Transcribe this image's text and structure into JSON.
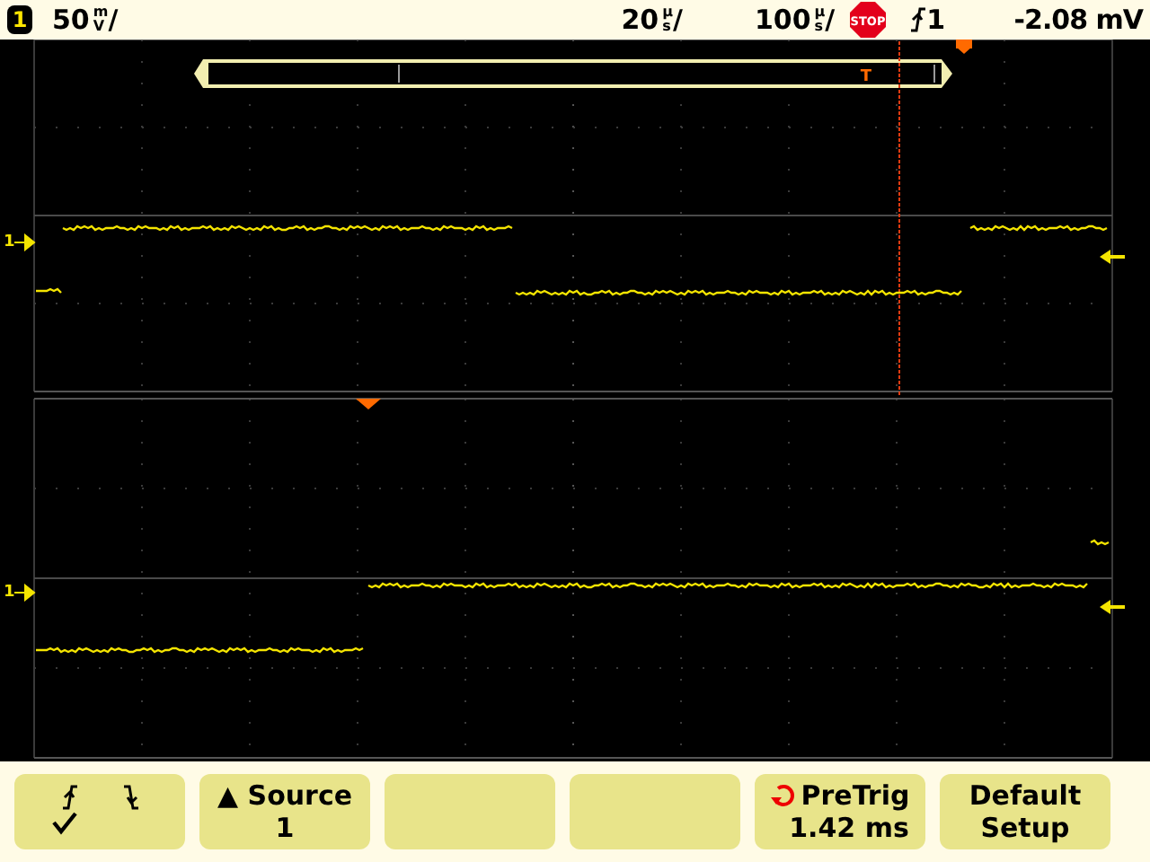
{
  "status_bar": {
    "channel": "1",
    "scale": {
      "value": "50",
      "unit_top": "m",
      "unit_bottom": "V",
      "slash": "/"
    },
    "delay": {
      "value": "20",
      "unit_top": "µ",
      "unit_bottom": "s",
      "slash": "/"
    },
    "timebase": {
      "value": "100",
      "unit_top": "µ",
      "unit_bottom": "s",
      "slash": "/"
    },
    "run_state": "STOP",
    "trigger_source": "1",
    "trigger_level": "-2.08 mV"
  },
  "display": {
    "zoom_marker": "T",
    "ground_markers": [
      {
        "label": "1"
      },
      {
        "label": "1"
      }
    ]
  },
  "softkeys": [
    {
      "kind": "edge",
      "checked": true
    },
    {
      "kind": "menu",
      "arrow": "▲",
      "label": "Source",
      "value": "1"
    },
    {
      "kind": "blank"
    },
    {
      "kind": "blank"
    },
    {
      "kind": "knob",
      "label": "PreTrig",
      "value": "1.42 ms"
    },
    {
      "kind": "text",
      "label": "Default",
      "value": "Setup"
    }
  ]
}
